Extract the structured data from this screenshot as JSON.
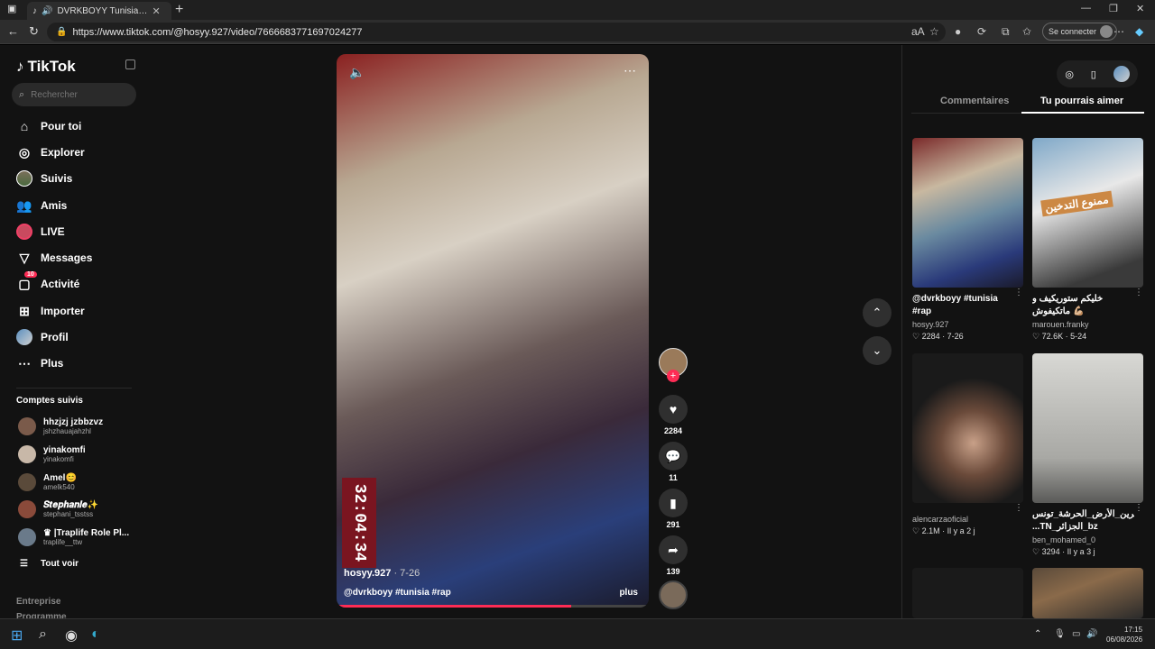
{
  "browser": {
    "tab_title": "DVRKBOYY Tunisia Rap — B",
    "url": "https://www.tiktok.com/@hosyy.927/video/7666683771697024277",
    "connect_label": "Se connecter"
  },
  "sidebar": {
    "brand": "TikTok",
    "search_placeholder": "Rechercher",
    "nav": [
      {
        "label": "Pour toi",
        "icon": "home-icon"
      },
      {
        "label": "Explorer",
        "icon": "compass-icon"
      },
      {
        "label": "Suivis",
        "icon": "following-avatar-icon"
      },
      {
        "label": "Amis",
        "icon": "friends-icon"
      },
      {
        "label": "LIVE",
        "icon": "live-icon"
      },
      {
        "label": "Messages",
        "icon": "send-icon"
      },
      {
        "label": "Activité",
        "icon": "activity-icon",
        "badge": "10"
      },
      {
        "label": "Importer",
        "icon": "upload-icon"
      },
      {
        "label": "Profil",
        "icon": "profile-icon"
      },
      {
        "label": "Plus",
        "icon": "more-icon"
      }
    ],
    "following_title": "Comptes suivis",
    "following": [
      {
        "name": "hhzjzj jzbbzvz",
        "handle": "jshzhauajahzhl"
      },
      {
        "name": "yinakomfi",
        "handle": "yinakomfi"
      },
      {
        "name": "Amel😊",
        "handle": "amelk540"
      },
      {
        "name": "𝑺𝒕𝒆𝒑𝒉𝒂𝒏𝒊𝒆✨",
        "handle": "stephani_tsstss"
      },
      {
        "name": "♛ |Traplife Role Pl...",
        "handle": "traplife__ttw"
      }
    ],
    "see_all": "Tout voir",
    "footer": [
      "Entreprise",
      "Programme"
    ]
  },
  "video": {
    "timer": "32:04:34",
    "author": "hosyy.927",
    "date": "· 7-26",
    "caption": "@dvrkboyy #tunisia #rap",
    "more": "plus",
    "progress": 0.75
  },
  "actions": {
    "likes": "2284",
    "comments": "11",
    "saves": "291",
    "shares": "139"
  },
  "right_panel": {
    "tab_comments": "Commentaires",
    "tab_suggestions": "Tu pourrais aimer",
    "cards": [
      {
        "title": "@dvrkboyy #tunisia #rap",
        "author": "hosyy.927",
        "likes": "2284",
        "date": "7-26"
      },
      {
        "title": "خليكم ستوريكيف و ماتكيفوش 💪🏼 #creatorsearchinsight...",
        "author": "marouen.franky",
        "likes": "72.6K",
        "date": "5-24",
        "overlay": "ممنوع التدخين"
      },
      {
        "title": "",
        "author": "alencarzaoficial",
        "likes": "2.1M",
        "date": "Il y a 2 j"
      },
      {
        "title": "القصرين_الأرض_الحرشة_تونس# ...TN_الجزائر_bz",
        "author": "ben_mohamed_0",
        "likes": "3294",
        "date": "Il y a 3 j"
      }
    ]
  },
  "taskbar": {
    "time": "17:15",
    "date": "06/08/2026"
  }
}
